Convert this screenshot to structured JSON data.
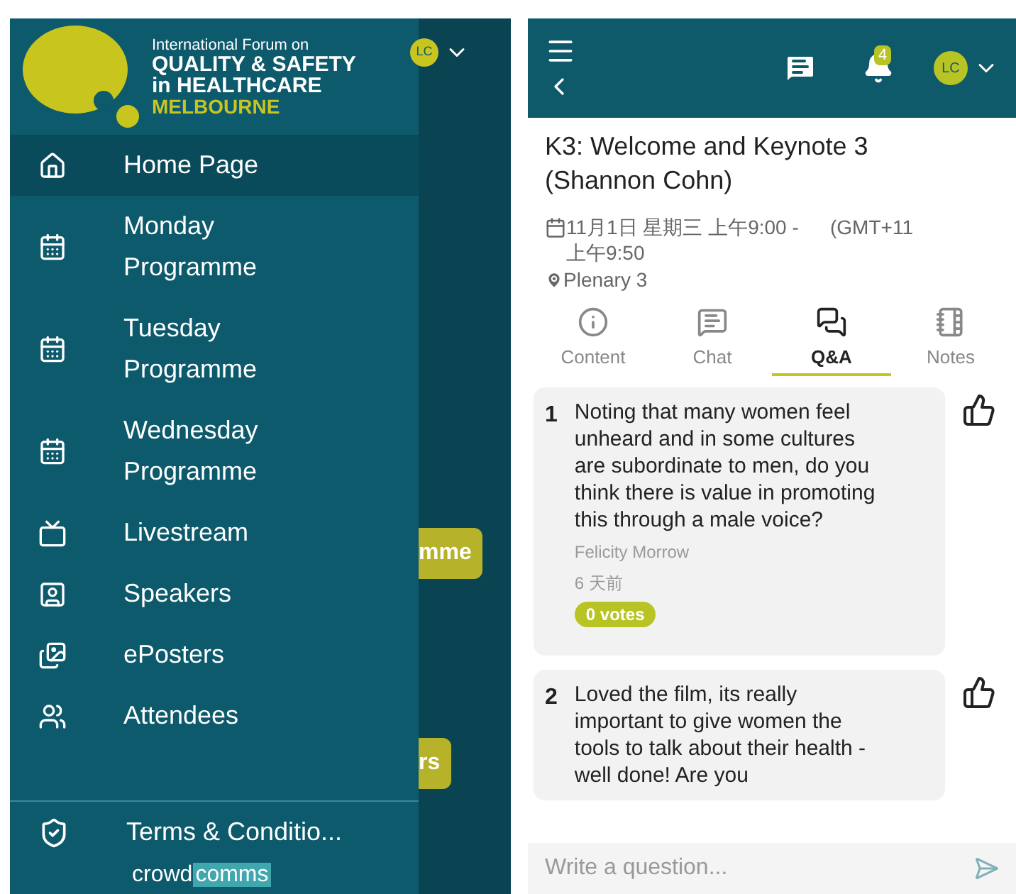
{
  "drawer": {
    "logo": {
      "line_1": "International Forum on",
      "line_2": "QUALITY & SAFETY",
      "line_3": "in HEALTHCARE",
      "line_4": "MELBOURNE"
    },
    "items": [
      {
        "label": "Home Page",
        "kind": "home",
        "selected": true
      },
      {
        "label": "Monday Programme",
        "kind": "calendar",
        "selected": false
      },
      {
        "label": "Tuesday Programme",
        "kind": "calendar",
        "selected": false
      },
      {
        "label": "Wednesday Programme",
        "kind": "calendar",
        "selected": false
      },
      {
        "label": "Livestream",
        "kind": "tv",
        "selected": false
      },
      {
        "label": "Speakers",
        "kind": "speaker",
        "selected": false
      },
      {
        "label": "ePosters",
        "kind": "poster",
        "selected": false
      },
      {
        "label": "Attendees",
        "kind": "people",
        "selected": false
      }
    ],
    "footer": {
      "label": "Terms & Conditio...",
      "brand_1": "crowd",
      "brand_2": "comms"
    }
  },
  "background_app": {
    "avatar": "LC",
    "buttons": [
      "mme",
      "rs"
    ]
  },
  "header": {
    "notification_count": "4",
    "avatar": "LC"
  },
  "session": {
    "title": "K3: Welcome and Keynote 3 (Shannon Cohn)",
    "date": "11月1日 星期三 上午9:00 - 上午9:50",
    "timezone": "(GMT+11",
    "location": "Plenary 3"
  },
  "tabs": [
    {
      "label": "Content",
      "kind": "info",
      "selected": false
    },
    {
      "label": "Chat",
      "kind": "chat",
      "selected": false
    },
    {
      "label": "Q&A",
      "kind": "qa",
      "selected": true
    },
    {
      "label": "Notes",
      "kind": "notes",
      "selected": false
    }
  ],
  "questions": [
    {
      "number": "1",
      "text": "Noting that many women feel unheard and in some cultures are subordinate to men, do you think there is value in promoting this through a male voice?",
      "author": "Felicity Morrow",
      "time": "6 天前",
      "votes": "0 votes"
    },
    {
      "number": "2",
      "text": "Loved the film, its really important to give women the tools to talk about their health - well done! Are you"
    }
  ],
  "input": {
    "placeholder": "Write a question..."
  }
}
